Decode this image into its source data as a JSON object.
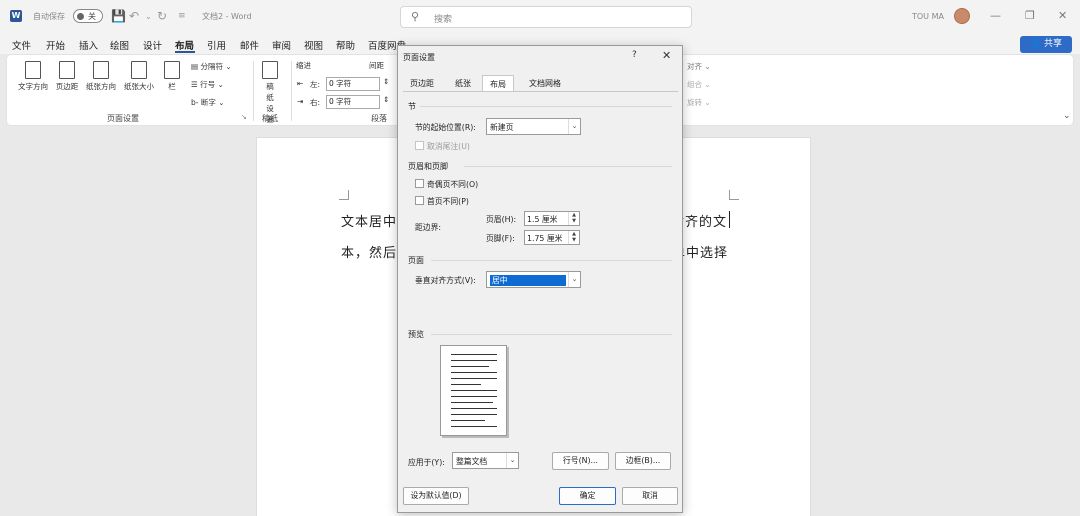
{
  "titlebar": {
    "autosave_label": "自动保存",
    "autosave_state": "关",
    "doc_title": "文档2 - Word",
    "search_placeholder": "搜索",
    "user_name": "TOU MA"
  },
  "menu": [
    "文件",
    "开始",
    "插入",
    "绘图",
    "设计",
    "布局",
    "引用",
    "邮件",
    "审阅",
    "视图",
    "帮助",
    "百度网盘"
  ],
  "menu_active": "布局",
  "share_label": "共享",
  "ribbon": {
    "page_setup_buttons": [
      "文字方向",
      "页边距",
      "纸张方向",
      "纸张大小",
      "栏"
    ],
    "small_items": [
      "分隔符",
      "行号",
      "断字"
    ],
    "draft_button": "稿纸设置",
    "group_page_setup": "页面设置",
    "group_draft": "稿纸",
    "group_paragraph": "段落",
    "indent_label": "缩进",
    "spacing_label": "间距",
    "indent_left_label": "左:",
    "indent_left_value": "0 字符",
    "indent_right_label": "右:",
    "indent_right_value": "0 字符",
    "arrange_items": [
      "对齐",
      "组合",
      "旋转"
    ]
  },
  "document": {
    "line1_left": "文本居中对",
    "line1_right": "对齐的文",
    "line2_left": "本，然后点",
    "line2_right": "单中选择"
  },
  "dialog": {
    "title": "页面设置",
    "help": "?",
    "close": "✕",
    "tabs": [
      "页边距",
      "纸张",
      "布局",
      "文档网格"
    ],
    "active_tab": "布局",
    "section_section": "节",
    "section_start_label": "节的起始位置(R):",
    "section_start_value": "新建页",
    "suppress_endnotes": "取消尾注(U)",
    "header_footer_section": "页眉和页脚",
    "odd_even_label": "奇偶页不同(O)",
    "first_page_label": "首页不同(P)",
    "margin_label": "距边界:",
    "header_label": "页眉(H):",
    "header_value": "1.5 厘米",
    "footer_label": "页脚(F):",
    "footer_value": "1.75 厘米",
    "page_section": "页面",
    "valign_label": "垂直对齐方式(V):",
    "valign_value": "居中",
    "preview_section": "预览",
    "apply_label": "应用于(Y):",
    "apply_value": "整篇文档",
    "line_numbers_button": "行号(N)...",
    "borders_button": "边框(B)...",
    "set_default_button": "设为默认值(D)",
    "ok_button": "确定",
    "cancel_button": "取消"
  }
}
